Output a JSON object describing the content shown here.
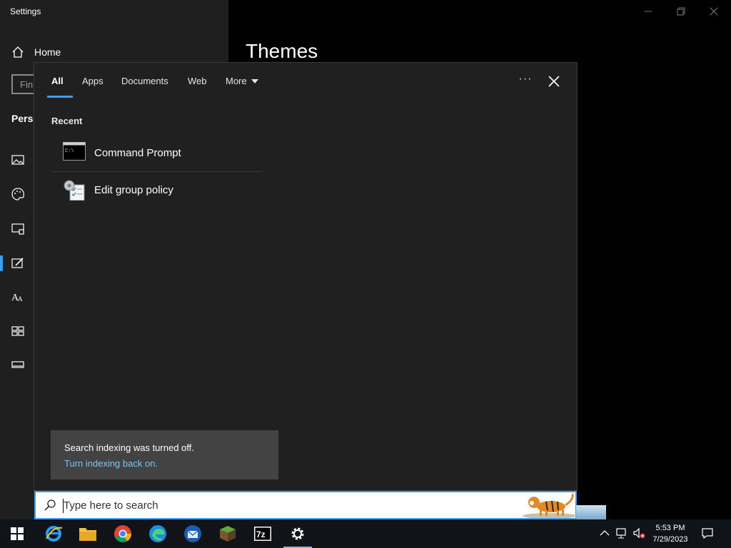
{
  "settings": {
    "title": "Settings",
    "home_label": "Home",
    "find_placeholder": "Fin",
    "section_label": "Perso",
    "page_title": "Themes"
  },
  "search_flyout": {
    "tabs": [
      {
        "label": "All",
        "selected": true
      },
      {
        "label": "Apps"
      },
      {
        "label": "Documents"
      },
      {
        "label": "Web"
      },
      {
        "label": "More"
      }
    ],
    "recent_label": "Recent",
    "results": [
      {
        "label": "Command Prompt",
        "icon": "command-prompt-icon"
      },
      {
        "label": "Edit group policy",
        "icon": "group-policy-icon"
      }
    ],
    "toast": {
      "message": "Search indexing was turned off.",
      "link": "Turn indexing back on."
    }
  },
  "searchbar": {
    "placeholder": "Type here to search"
  },
  "taskbar": {
    "apps": [
      {
        "name": "start",
        "icon": "windows-logo-icon"
      },
      {
        "name": "internet-explorer",
        "icon": "internet-explorer-icon"
      },
      {
        "name": "file-explorer",
        "icon": "folder-icon"
      },
      {
        "name": "chrome",
        "icon": "chrome-icon"
      },
      {
        "name": "edge",
        "icon": "edge-icon"
      },
      {
        "name": "thunderbird",
        "icon": "thunderbird-icon"
      },
      {
        "name": "minecraft",
        "icon": "grass-block-icon"
      },
      {
        "name": "7zip",
        "icon": "7zip-icon"
      },
      {
        "name": "settings",
        "icon": "gear-icon"
      }
    ],
    "time": "5:53 PM",
    "date": "7/29/2023"
  },
  "colors": {
    "accent": "#3b9df0",
    "flyout_bg": "#202020",
    "link": "#7cc4f4"
  }
}
